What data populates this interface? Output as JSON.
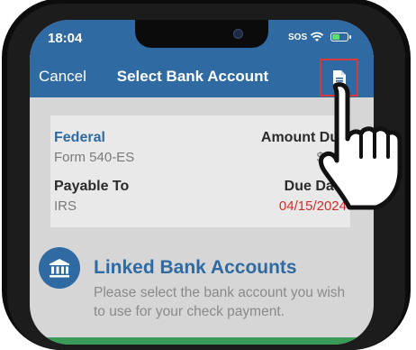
{
  "status_bar": {
    "time": "18:04",
    "sos": "SOS"
  },
  "nav": {
    "cancel_label": "Cancel",
    "title": "Select Bank Account",
    "action_icon": "document-icon"
  },
  "summary": {
    "federal_label": "Federal",
    "form": "Form 540-ES",
    "amount_due_label": "Amount Due",
    "amount_due_value": "$123",
    "payable_to_label": "Payable To",
    "payable_to_value": "IRS",
    "due_date_label": "Due Date",
    "due_date_value": "04/15/2024"
  },
  "linked_accounts": {
    "icon": "bank-icon",
    "title": "Linked Bank Accounts",
    "description": "Please select the bank account you wish to use for your check payment."
  },
  "colors": {
    "brand_blue": "#2f6aa3",
    "due_date_red": "#c9302c",
    "highlight_red": "#d63a3a"
  }
}
